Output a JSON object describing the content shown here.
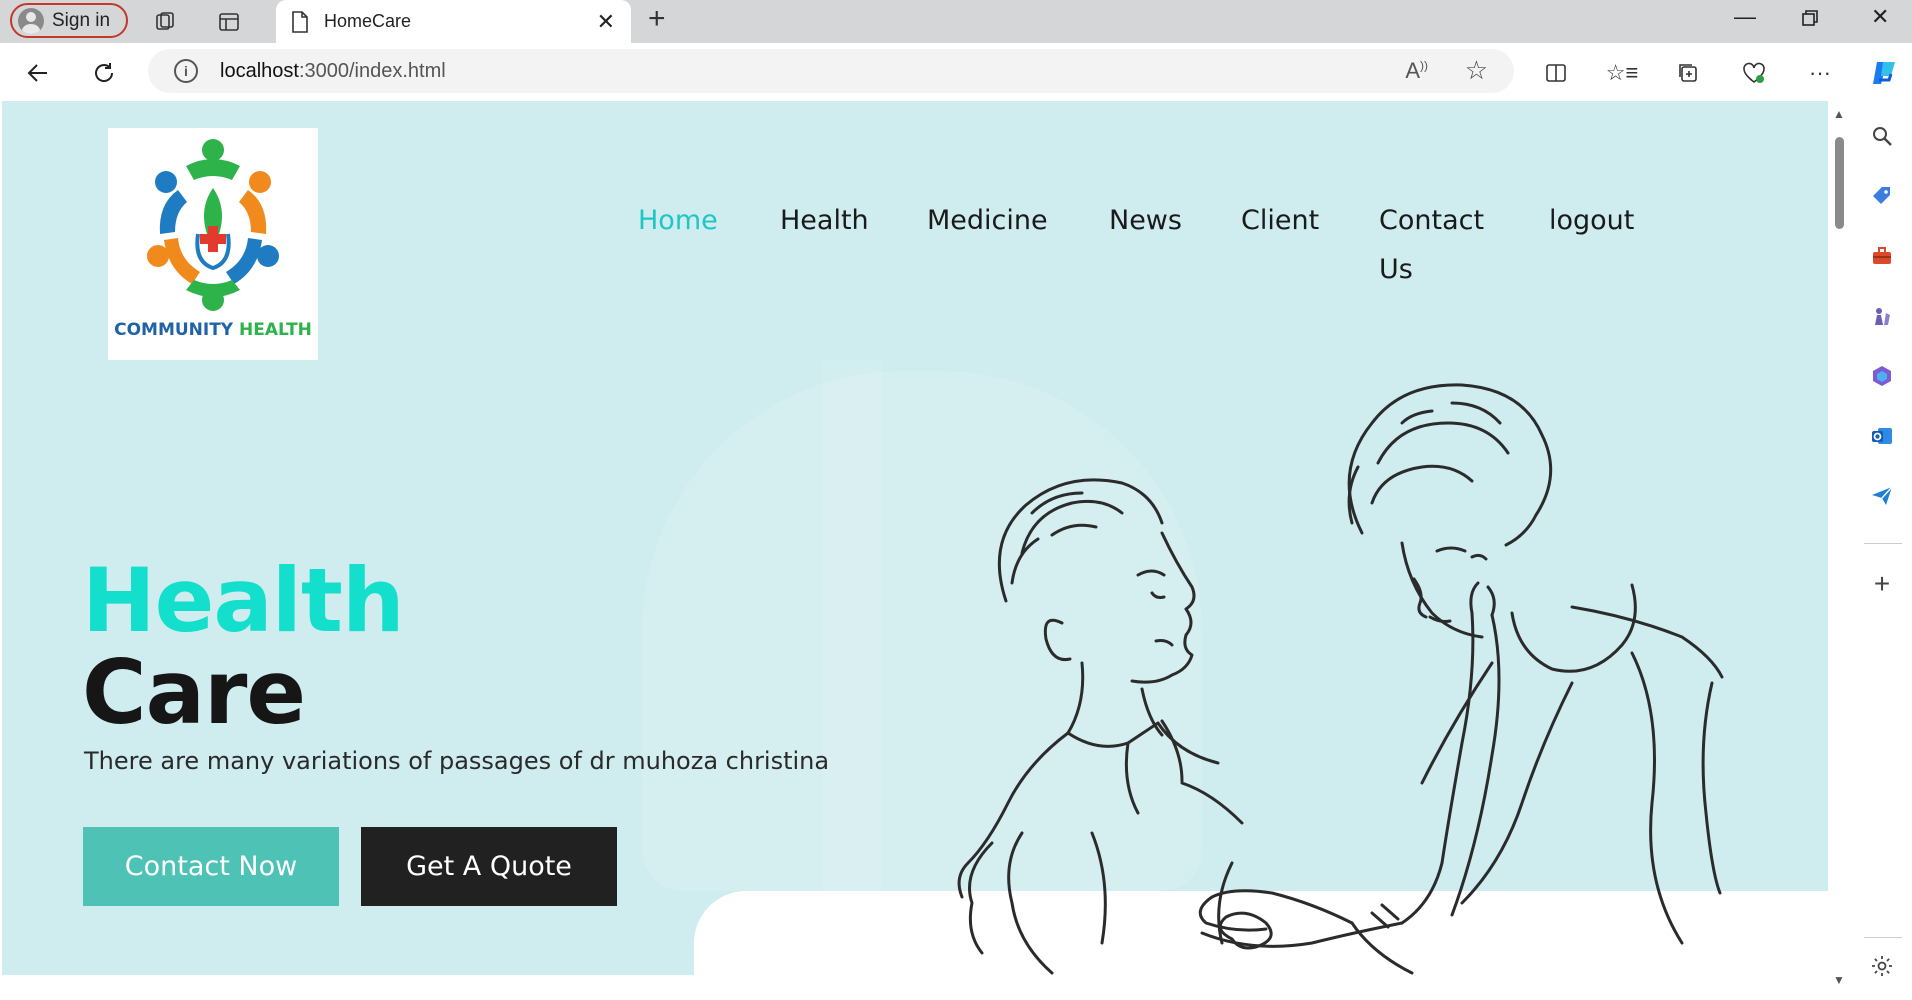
{
  "browser": {
    "profile_label": "Sign in",
    "tab_title": "HomeCare",
    "address_host": "localhost",
    "address_path": ":3000/index.html"
  },
  "site": {
    "logo": {
      "text_left": "COMMUNITY",
      "text_right": "HEALTH"
    },
    "nav": [
      "Home",
      "Health",
      "Medicine",
      "News",
      "Client",
      "Contact Us",
      "logout"
    ],
    "active_nav": "Home"
  },
  "hero": {
    "title_line1": "Health",
    "title_line2": "Care",
    "subtitle": "There are many variations of passages of dr muhoza christina",
    "btn_contact": "Contact Now",
    "btn_quote": "Get A Quote"
  },
  "colors": {
    "accent": "#13dfcc",
    "hero_bg": "#cfecee",
    "contact_btn": "#4fc2b6",
    "quote_btn": "#212121"
  }
}
